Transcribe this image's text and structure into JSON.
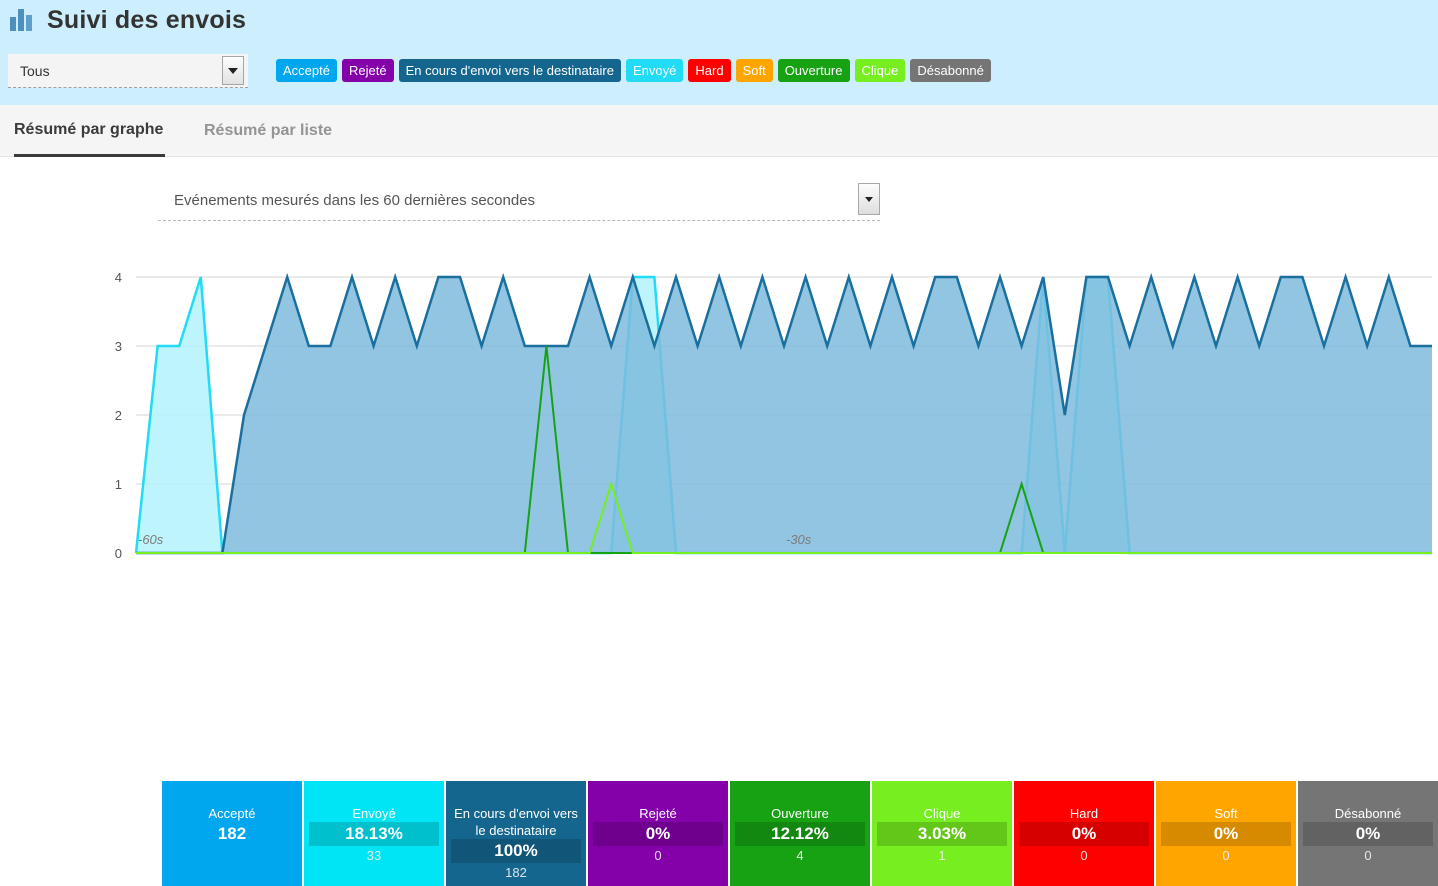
{
  "header": {
    "title": "Suivi des envois",
    "icon": "bar-chart-icon",
    "scope_select": {
      "value": "Tous",
      "icon": "chevron-down-icon"
    },
    "filters": [
      {
        "label": "Accepté",
        "color": "#00a6ee"
      },
      {
        "label": "Rejeté",
        "color": "#8400a8"
      },
      {
        "label": "En cours d'envoi vers le destinataire",
        "color": "#15668f"
      },
      {
        "label": "Envoyé",
        "color": "#22dbf4"
      },
      {
        "label": "Hard",
        "color": "#ff0000"
      },
      {
        "label": "Soft",
        "color": "#ffa500"
      },
      {
        "label": "Ouverture",
        "color": "#17a214"
      },
      {
        "label": "Clique",
        "color": "#76ee20"
      },
      {
        "label": "Désabonné",
        "color": "#757575"
      }
    ]
  },
  "tabs": [
    {
      "label": "Résumé par graphe",
      "active": true
    },
    {
      "label": "Résumé par liste",
      "active": false
    }
  ],
  "range_select": {
    "value": "Evénements mesurés dans les 60 dernières secondes",
    "icon": "chevron-down-icon"
  },
  "chart_data": {
    "type": "area",
    "title": "Evénements mesurés dans les 60 dernières secondes",
    "xlabel": "",
    "ylabel": "",
    "ylim": [
      0,
      4
    ],
    "yticks": [
      0,
      1,
      2,
      3,
      4
    ],
    "xticks": [
      "-60s",
      "-30s"
    ],
    "xtick_positions": [
      0,
      30
    ],
    "xlim": [
      0,
      60
    ],
    "grid": true,
    "legend": "none",
    "series": [
      {
        "name": "Envoyé",
        "color": "#22dbf4",
        "fill": "#b3f2fb",
        "x": [
          0,
          1,
          2,
          3,
          4,
          5,
          6,
          7,
          8,
          9,
          10,
          11,
          12,
          13,
          14,
          15,
          16,
          17,
          18,
          19,
          20,
          21,
          22,
          23,
          24,
          25,
          26,
          27,
          28,
          29,
          30,
          31,
          32,
          33,
          34,
          35,
          36,
          37,
          38,
          39,
          40,
          41,
          42,
          43,
          44,
          45,
          46,
          47,
          48,
          49,
          50,
          51,
          52,
          53,
          54,
          55,
          56,
          57,
          58,
          59,
          60
        ],
        "values": [
          0,
          3,
          3,
          4,
          0,
          0,
          0,
          0,
          0,
          0,
          0,
          0,
          0,
          0,
          0,
          0,
          0,
          0,
          0,
          0,
          0,
          0,
          0,
          4,
          4,
          0,
          0,
          0,
          0,
          0,
          0,
          0,
          0,
          0,
          0,
          0,
          0,
          0,
          0,
          0,
          0,
          0,
          4,
          0,
          4,
          4,
          0,
          0,
          0,
          0,
          0,
          0,
          0,
          0,
          0,
          0,
          0,
          0,
          0,
          0,
          0
        ]
      },
      {
        "name": "En cours d'envoi vers le destinataire",
        "color": "#1a6f9e",
        "fill": "#7ebbdd",
        "x": [
          0,
          1,
          2,
          3,
          4,
          5,
          6,
          7,
          8,
          9,
          10,
          11,
          12,
          13,
          14,
          15,
          16,
          17,
          18,
          19,
          20,
          21,
          22,
          23,
          24,
          25,
          26,
          27,
          28,
          29,
          30,
          31,
          32,
          33,
          34,
          35,
          36,
          37,
          38,
          39,
          40,
          41,
          42,
          43,
          44,
          45,
          46,
          47,
          48,
          49,
          50,
          51,
          52,
          53,
          54,
          55,
          56,
          57,
          58,
          59,
          60
        ],
        "values": [
          0,
          0,
          0,
          0,
          0,
          2,
          3,
          4,
          3,
          3,
          4,
          3,
          4,
          3,
          4,
          4,
          3,
          4,
          3,
          3,
          3,
          4,
          3,
          4,
          3,
          4,
          3,
          4,
          3,
          4,
          3,
          4,
          3,
          4,
          3,
          4,
          3,
          4,
          4,
          3,
          4,
          3,
          4,
          2,
          4,
          4,
          3,
          4,
          3,
          4,
          3,
          4,
          3,
          4,
          4,
          3,
          4,
          3,
          4,
          3,
          3
        ]
      },
      {
        "name": "Ouverture",
        "color": "#17a214",
        "fill": "rgba(23,162,20,0)",
        "x": [
          0,
          1,
          2,
          3,
          4,
          5,
          6,
          7,
          8,
          9,
          10,
          11,
          12,
          13,
          14,
          15,
          16,
          17,
          18,
          19,
          20,
          21,
          22,
          23,
          24,
          25,
          26,
          27,
          28,
          29,
          30,
          31,
          32,
          33,
          34,
          35,
          36,
          37,
          38,
          39,
          40,
          41,
          42,
          43,
          44,
          45,
          46,
          47,
          48,
          49,
          50,
          51,
          52,
          53,
          54,
          55,
          56,
          57,
          58,
          59,
          60
        ],
        "values": [
          0,
          0,
          0,
          0,
          0,
          0,
          0,
          0,
          0,
          0,
          0,
          0,
          0,
          0,
          0,
          0,
          0,
          0,
          0,
          3,
          0,
          0,
          0,
          0,
          0,
          0,
          0,
          0,
          0,
          0,
          0,
          0,
          0,
          0,
          0,
          0,
          0,
          0,
          0,
          0,
          0,
          1,
          0,
          0,
          0,
          0,
          0,
          0,
          0,
          0,
          0,
          0,
          0,
          0,
          0,
          0,
          0,
          0,
          0,
          0,
          0
        ]
      },
      {
        "name": "Clique",
        "color": "#76ee20",
        "fill": "rgba(118,238,32,0)",
        "x": [
          0,
          1,
          2,
          3,
          4,
          5,
          6,
          7,
          8,
          9,
          10,
          11,
          12,
          13,
          14,
          15,
          16,
          17,
          18,
          19,
          20,
          21,
          22,
          23,
          24,
          25,
          26,
          27,
          28,
          29,
          30,
          31,
          32,
          33,
          34,
          35,
          36,
          37,
          38,
          39,
          40,
          41,
          42,
          43,
          44,
          45,
          46,
          47,
          48,
          49,
          50,
          51,
          52,
          53,
          54,
          55,
          56,
          57,
          58,
          59,
          60
        ],
        "values": [
          0,
          0,
          0,
          0,
          0,
          0,
          0,
          0,
          0,
          0,
          0,
          0,
          0,
          0,
          0,
          0,
          0,
          0,
          0,
          0,
          0,
          0,
          1,
          0,
          0,
          0,
          0,
          0,
          0,
          0,
          0,
          0,
          0,
          0,
          0,
          0,
          0,
          0,
          0,
          0,
          0,
          0,
          0,
          0,
          0,
          0,
          0,
          0,
          0,
          0,
          0,
          0,
          0,
          0,
          0,
          0,
          0,
          0,
          0,
          0,
          0
        ]
      }
    ]
  },
  "cards": [
    {
      "label": "Accepté",
      "percent": null,
      "count": "182",
      "big": "182",
      "color": "#00a6ee"
    },
    {
      "label": "Envoyé",
      "percent": "18.13%",
      "count": "33",
      "color": "#00e5f5"
    },
    {
      "label": "En cours d'envoi vers le destinataire",
      "percent": "100%",
      "count": "182",
      "color": "#15668f"
    },
    {
      "label": "Rejeté",
      "percent": "0%",
      "count": "0",
      "color": "#8400a8"
    },
    {
      "label": "Ouverture",
      "percent": "12.12%",
      "count": "4",
      "color": "#17a214"
    },
    {
      "label": "Clique",
      "percent": "3.03%",
      "count": "1",
      "color": "#76ee20"
    },
    {
      "label": "Hard",
      "percent": "0%",
      "count": "0",
      "color": "#ff0000"
    },
    {
      "label": "Soft",
      "percent": "0%",
      "count": "0",
      "color": "#ffa500"
    },
    {
      "label": "Désabonné",
      "percent": "0%",
      "count": "0",
      "color": "#757575"
    }
  ]
}
